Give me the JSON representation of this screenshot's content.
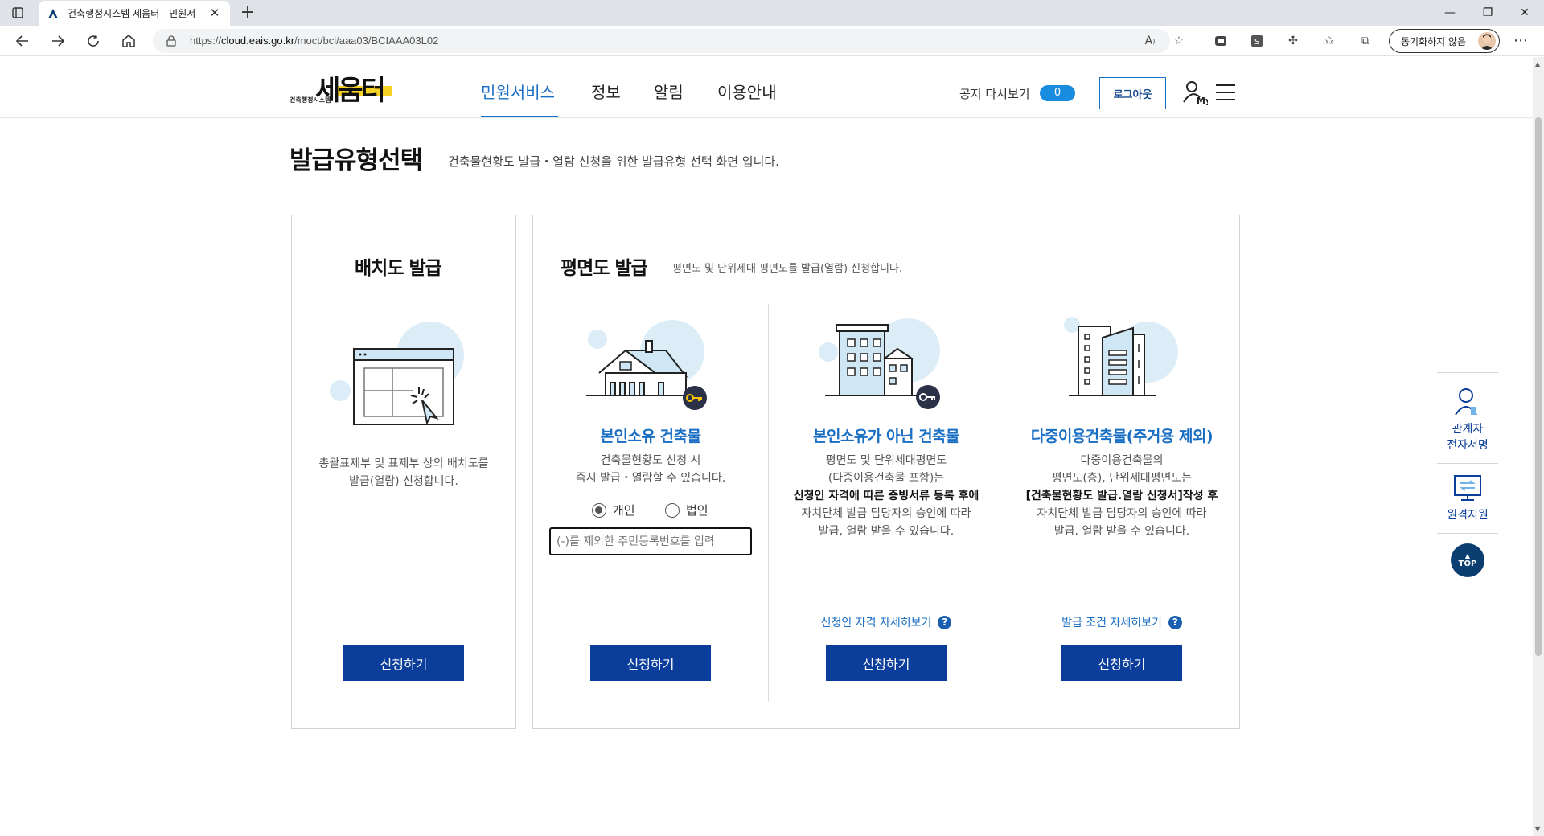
{
  "browser": {
    "tab_title": "건축행정시스템 세움터 - 민원서",
    "url_prefix": "https://",
    "url_domain": "cloud.eais.go.kr",
    "url_path": "/moct/bci/aaa03/BCIAAA03L02",
    "sync_label": "동기화하지 않음"
  },
  "header": {
    "logo_main": "세움터",
    "logo_sub": "건축행정시스템",
    "nav": [
      "민원서비스",
      "정보",
      "알림",
      "이용안내"
    ],
    "notice_label": "공지 다시보기",
    "notice_count": "0",
    "logout_label": "로그아웃"
  },
  "page": {
    "title": "발급유형선택",
    "description": "건축물현황도 발급・열람 신청을 위한 발급유형 선택 화면 입니다."
  },
  "site_plan": {
    "title": "배치도 발급",
    "desc": [
      "총괄표제부 및 표제부 상의 배치도를",
      "발급(열람) 신청합니다."
    ],
    "button": "신청하기"
  },
  "floor_plan": {
    "title": "평면도 발급",
    "subtitle": "평면도 및 단위세대 평면도를 발급(열람) 신청합니다.",
    "options": [
      {
        "title": "본인소유 건축물",
        "desc": [
          "건축물현황도 신청 시",
          "즉시 발급・열람할 수 있습니다."
        ],
        "radio_individual": "개인",
        "radio_corporate": "법인",
        "input_placeholder": "(-)를 제외한 주민등록번호를 입력",
        "button": "신청하기"
      },
      {
        "title": "본인소유가 아닌 건축물",
        "desc": [
          "평면도 및 단위세대평면도",
          "(다중이용건축물 포함)는",
          "신청인 자격에 따른 증빙서류 등록 후에",
          "자치단체 발급 담당자의 승인에 따라",
          "발급, 열람 받을 수 있습니다."
        ],
        "link": "신청인 자격 자세히보기",
        "button": "신청하기"
      },
      {
        "title": "다중이용건축물(주거용 제외)",
        "desc": [
          "다중이용건축물의",
          "평면도(층), 단위세대평면도는",
          "[건축물현황도 발급.열람 신청서]작성 후",
          "자치단체 발급 담당자의 승인에 따라",
          "발급. 열람 받을 수 있습니다."
        ],
        "link": "발급 조건 자세히보기",
        "button": "신청하기"
      }
    ]
  },
  "quick_menu": {
    "esign": [
      "관계자",
      "전자서명"
    ],
    "remote": "원격지원",
    "top": "TOP"
  },
  "colors": {
    "accent_blue": "#1a6fc4",
    "button_navy": "#0b3e9b",
    "logo_yellow": "#f6d224"
  }
}
